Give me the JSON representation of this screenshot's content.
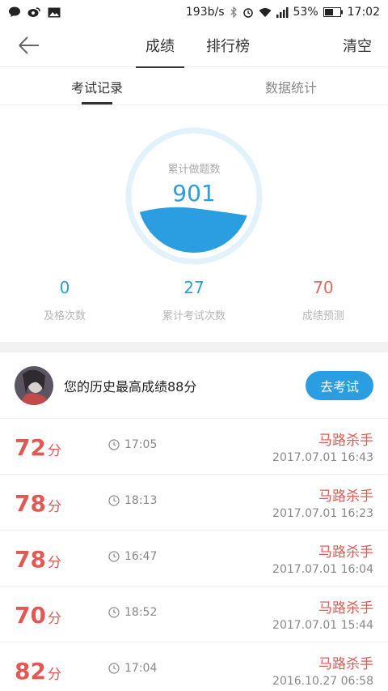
{
  "status_bar": {
    "speed": "193b/s",
    "battery": "53%",
    "time": "17:02"
  },
  "header": {
    "tabs": [
      {
        "label": "成绩"
      },
      {
        "label": "排行榜"
      }
    ],
    "clear_label": "清空"
  },
  "subtabs": [
    {
      "label": "考试记录"
    },
    {
      "label": "数据统计"
    }
  ],
  "gauge": {
    "label": "累计做题数",
    "value": "901"
  },
  "stats": [
    {
      "value": "0",
      "label": "及格次数"
    },
    {
      "value": "27",
      "label": "累计考试次数"
    },
    {
      "value": "70",
      "label": "成绩预测"
    }
  ],
  "best": {
    "text": "您的历史最高成绩88分",
    "button": "去考试"
  },
  "records": [
    {
      "score": "72",
      "unit": "分",
      "duration": "17:05",
      "name": "马路杀手",
      "date": "2017.07.01  16:43"
    },
    {
      "score": "78",
      "unit": "分",
      "duration": "18:13",
      "name": "马路杀手",
      "date": "2017.07.01  16:23"
    },
    {
      "score": "78",
      "unit": "分",
      "duration": "16:47",
      "name": "马路杀手",
      "date": "2017.07.01  16:04"
    },
    {
      "score": "70",
      "unit": "分",
      "duration": "18:52",
      "name": "马路杀手",
      "date": "2017.07.01  15:44"
    },
    {
      "score": "82",
      "unit": "分",
      "duration": "17:04",
      "name": "马路杀手",
      "date": "2016.10.27  06:58"
    }
  ],
  "colors": {
    "accent": "#2a9ee0",
    "score_red": "#e05a55"
  }
}
